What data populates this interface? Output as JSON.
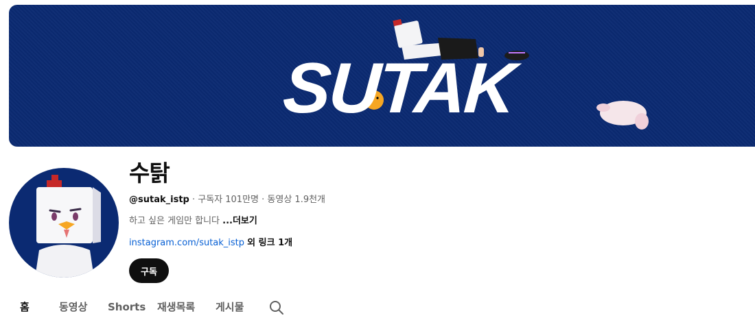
{
  "banner": {
    "title": "SUTAK"
  },
  "channel": {
    "name": "수탉",
    "handle": "@sutak_istp",
    "subscribers": "구독자 101만명",
    "videos": "동영상 1.9천개",
    "separator": " · ",
    "description": "하고 싶은 게임만 합니다",
    "more_label": "...더보기",
    "link_text": "instagram.com/sutak_istp",
    "extra_links": "외 링크 1개"
  },
  "subscribe_label": "구독",
  "tabs": [
    {
      "label": "홈",
      "active": true
    },
    {
      "label": "동영상",
      "active": false
    },
    {
      "label": "Shorts",
      "active": false
    },
    {
      "label": "재생목록",
      "active": false
    },
    {
      "label": "게시물",
      "active": false
    }
  ],
  "icons": {
    "tab_search": "search-icon"
  },
  "colors": {
    "banner_bg": "#0b2a72",
    "link": "#065fd4",
    "subscribe_bg": "#0f0f0f"
  }
}
